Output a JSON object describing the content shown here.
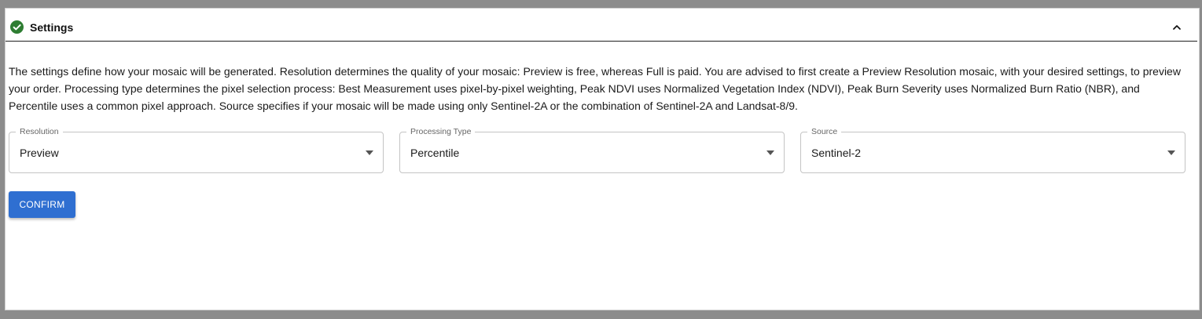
{
  "panel": {
    "title": "Settings",
    "status_icon": "check-circle-icon",
    "collapse_icon": "chevron-up-icon",
    "description": "The settings define how your mosaic will be generated. Resolution determines the quality of your mosaic: Preview is free, whereas Full is paid. You are advised to first create a Preview Resolution mosaic, with your desired settings, to preview your order. Processing type determines the pixel selection process: Best Measurement uses pixel-by-pixel weighting, Peak NDVI uses Normalized Vegetation Index (NDVI), Peak Burn Severity uses Normalized Burn Ratio (NBR), and Percentile uses a common pixel approach. Source specifies if your mosaic will be made using only Sentinel-2A or the combination of Sentinel-2A and Landsat-8/9."
  },
  "fields": {
    "resolution": {
      "label": "Resolution",
      "value": "Preview"
    },
    "processing_type": {
      "label": "Processing Type",
      "value": "Percentile"
    },
    "source": {
      "label": "Source",
      "value": "Sentinel-2"
    }
  },
  "actions": {
    "confirm_label": "CONFIRM"
  },
  "colors": {
    "accent": "#2f6fd1",
    "success": "#2e7d32",
    "border": "#c4c4c4"
  }
}
